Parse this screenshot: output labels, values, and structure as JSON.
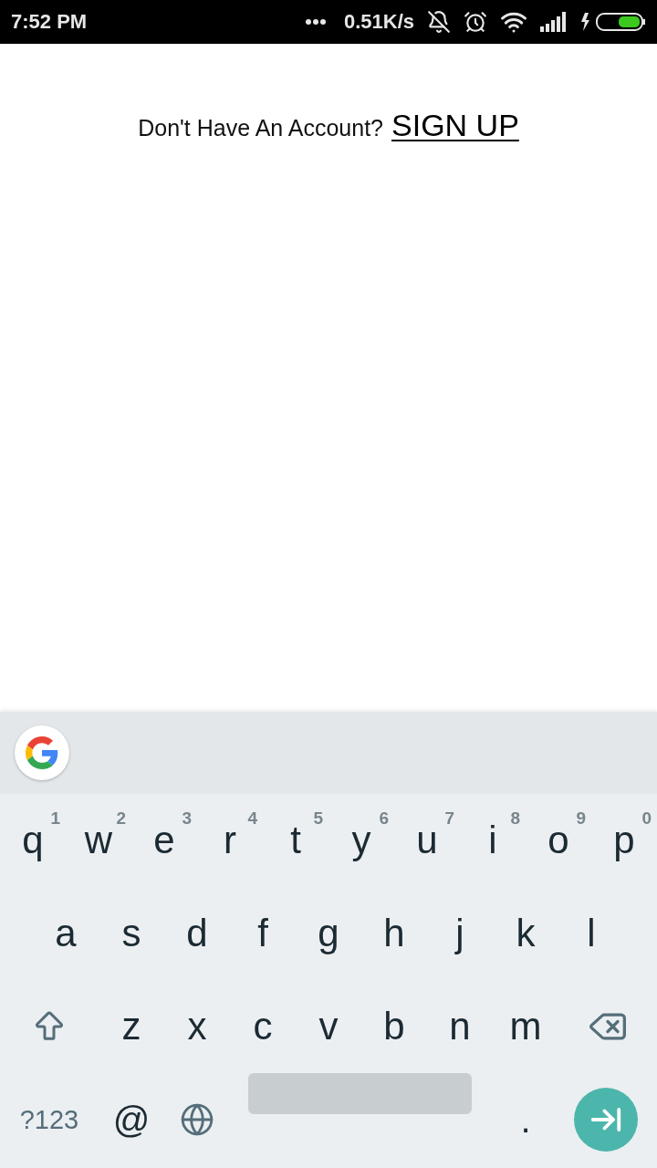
{
  "status_bar": {
    "time": "7:52 PM",
    "speed": "0.51K/s"
  },
  "signup_prompt": {
    "text": "Don't Have An Account?",
    "link": "SIGN UP"
  },
  "keyboard": {
    "rows": [
      {
        "keys": [
          {
            "kind": "letter",
            "label": "q",
            "hint": "1"
          },
          {
            "kind": "letter",
            "label": "w",
            "hint": "2"
          },
          {
            "kind": "letter",
            "label": "e",
            "hint": "3"
          },
          {
            "kind": "letter",
            "label": "r",
            "hint": "4"
          },
          {
            "kind": "letter",
            "label": "t",
            "hint": "5"
          },
          {
            "kind": "letter",
            "label": "y",
            "hint": "6"
          },
          {
            "kind": "letter",
            "label": "u",
            "hint": "7"
          },
          {
            "kind": "letter",
            "label": "i",
            "hint": "8"
          },
          {
            "kind": "letter",
            "label": "o",
            "hint": "9"
          },
          {
            "kind": "letter",
            "label": "p",
            "hint": "0"
          }
        ]
      },
      {
        "keys": [
          {
            "kind": "letter",
            "label": "a"
          },
          {
            "kind": "letter",
            "label": "s"
          },
          {
            "kind": "letter",
            "label": "d"
          },
          {
            "kind": "letter",
            "label": "f"
          },
          {
            "kind": "letter",
            "label": "g"
          },
          {
            "kind": "letter",
            "label": "h"
          },
          {
            "kind": "letter",
            "label": "j"
          },
          {
            "kind": "letter",
            "label": "k"
          },
          {
            "kind": "letter",
            "label": "l"
          }
        ]
      },
      {
        "keys": [
          {
            "kind": "shift"
          },
          {
            "kind": "letter",
            "label": "z"
          },
          {
            "kind": "letter",
            "label": "x"
          },
          {
            "kind": "letter",
            "label": "c"
          },
          {
            "kind": "letter",
            "label": "v"
          },
          {
            "kind": "letter",
            "label": "b"
          },
          {
            "kind": "letter",
            "label": "n"
          },
          {
            "kind": "letter",
            "label": "m"
          },
          {
            "kind": "backspace"
          }
        ]
      },
      {
        "keys": [
          {
            "kind": "symbols",
            "label": "?123"
          },
          {
            "kind": "char",
            "label": "@"
          },
          {
            "kind": "globe"
          },
          {
            "kind": "space"
          },
          {
            "kind": "char",
            "label": "."
          },
          {
            "kind": "enter"
          }
        ]
      }
    ]
  }
}
